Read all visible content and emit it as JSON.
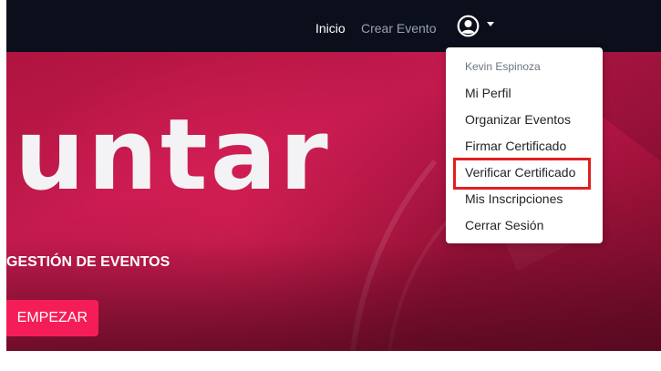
{
  "navbar": {
    "links": [
      {
        "label": "Inicio"
      },
      {
        "label": "Crear Evento"
      }
    ],
    "user_icon": "user-circle-icon",
    "caret_icon": "caret-down-icon"
  },
  "hero": {
    "title": "Juntar",
    "subtitle": "GESTIÓN DE EVENTOS",
    "cta_label": "EMPEZAR"
  },
  "dropdown": {
    "header": "Kevin Espinoza",
    "items": [
      {
        "label": "Mi Perfil"
      },
      {
        "label": "Organizar Eventos"
      },
      {
        "label": "Firmar Certificado"
      },
      {
        "label": "Verificar Certificado"
      },
      {
        "label": "Mis Inscripciones"
      },
      {
        "label": "Cerrar Sesión"
      }
    ]
  },
  "colors": {
    "navbar_bg": "#0b0f1b",
    "hero_primary": "#c21a4e",
    "cta_bg": "#f51d57",
    "highlight": "#e02020"
  }
}
